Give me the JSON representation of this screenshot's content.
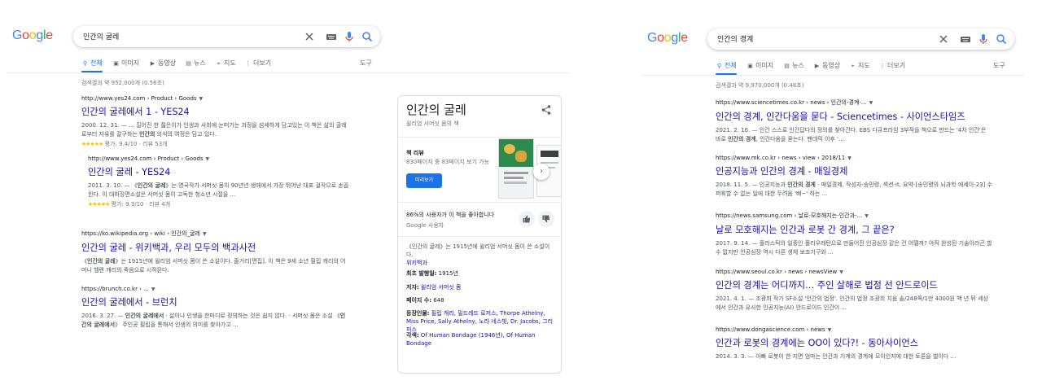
{
  "left": {
    "logo": "Google",
    "query": "인간의 굴레",
    "tabs": [
      {
        "label": "전체",
        "icon": "search-icon"
      },
      {
        "label": "이미지",
        "icon": "image-icon"
      },
      {
        "label": "동영상",
        "icon": "play-icon"
      },
      {
        "label": "뉴스",
        "icon": "news-icon"
      },
      {
        "label": "지도",
        "icon": "map-pin-icon"
      },
      {
        "label": "더보기",
        "icon": "more-vert-icon"
      }
    ],
    "tools_label": "도구",
    "stats": "검색결과 약 952,000개 (0.56초)",
    "results": [
      {
        "cite": "http://www.yes24.com › Product › Goods",
        "title": "인간의 굴레에서 1 - YES24",
        "snippet_html": "2000. 12. 31. — ... 질어진 한 젊은이가 인생과 사회에 눈떠가는 과정을 섬세하게 담고있는 이 책은 삶의 굴레로부터 자유를 갈구하는 <b>인간의</b> 의식의 여정은 담고 있다.",
        "rating_stars": "★★★★★",
        "rating_text": "평가: 9.4/10 · 리뷰 53개"
      },
      {
        "cite": "http://www.yes24.com › Product › Goods",
        "title": "인간의 굴레 - YES24",
        "snippet_html": "2011. 3. 10. — 《<b>인간의 굴레</b>》는 영국작가 서머싯 몸의 90년년 생애에서 가장 뛰어난 대표 걸작으로 손꼽힌다. 이 대하장편소설은 서머싯 몸이 고독한 청소년 시절을 ...",
        "rating_stars": "★★★★★",
        "rating_text": "평가: 9.3/10 · 리뷰 4개"
      },
      {
        "cite": "https://ko.wikipedia.org › wiki › 인간의_굴레",
        "title": "인간의 굴레 - 위키백과, 우리 모두의 백과사전",
        "snippet_html": "《<b>인간의 굴레</b>》는 1915년에 윌리엄 서머싯 몸이 쓴 소설이다. 줄거리[편집]. 이 책은 9세 소년 필립 캐리의 어머니 헬렌 캐리의 죽음으로 시작된다."
      },
      {
        "cite": "https://brunch.co.kr › ...",
        "title": "인간의 굴레에서 - 브런치",
        "snippet_html": "2016. 3. 27. — <b>인간의 굴레에서</b> · 삶이나 인생을 한마디로 정의하는 것은 쉽지 않다. · 서머싯 몸은 소설 《<b>인간의 굴레에서</b>》 주인공 필립을 통해서 인생의 의미를 찾아가고 ..."
      }
    ],
    "kp": {
      "title": "인간의 굴레",
      "subtitle": "윌리엄 서머싯 몸의 책",
      "book_review_label": "책 리뷰",
      "book_review_sub": "830페이지 중 83페이지 보기 가능",
      "preview_button": "미리보기",
      "like_text": "86%의 사용자가 이 책을 좋아합니다",
      "like_source": "Google 사용자",
      "desc": "《인간의 굴레》는 1915년에 윌리엄 서머싯 몸이 쓴 소설이다.",
      "wiki_link": "위키백과",
      "facts": [
        {
          "k": "최초 발행일:",
          "v": "1915년",
          "link": false
        },
        {
          "k": "저자:",
          "v": "윌리엄 서머싯 몸",
          "link": true
        },
        {
          "k": "페이지 수:",
          "v": "648",
          "link": false
        },
        {
          "k": "등장인물:",
          "v": "필립 캐리, 밀드레드 로저스, Thorpe Athelny, Miss Price, Sally Athelny, 노라 네스빗, Dr. Jacobs, 그리피스",
          "link": true
        },
        {
          "k": "각색:",
          "v": "Of Human Bondage (1946년), Of Human Bondage",
          "link": true
        }
      ]
    }
  },
  "right": {
    "logo": "Google",
    "query": "인간의 경계",
    "tabs": [
      {
        "label": "전체",
        "icon": "search-icon"
      },
      {
        "label": "이미지",
        "icon": "image-icon"
      },
      {
        "label": "뉴스",
        "icon": "news-icon"
      },
      {
        "label": "동영상",
        "icon": "play-icon"
      },
      {
        "label": "지도",
        "icon": "map-pin-icon"
      },
      {
        "label": "더보기",
        "icon": "more-vert-icon"
      }
    ],
    "tools_label": "도구",
    "stats": "검색결과 약 9,970,000개 (0.48초)",
    "results": [
      {
        "cite": "https://www.sciencetimes.co.kr › news › 인간의-경계-...",
        "title": "인간의 경계, 인간다움을 묻다 - Sciencetimes - 사이언스타임즈",
        "snippet_html": "2021. 2. 16. — 인간 스스로 인간답다의 정의를 찾아간다. EBS 다큐프라임 3부작을 책으로 만드는 '4차 인간'은 바로 <b>인간의 경계</b>, 인간다움을 묻는다. 팬데믹 이후 '..."
      },
      {
        "cite": "https://www.mk.co.kr › news › view › 2018/11",
        "title": "인공지능과 인간의 경계 - 매일경제",
        "snippet_html": "2018. 11. 5. — 인공지능과 <b>인간의 경계</b> - 매일경제, 작성자-송민령, 섹션-it, 요약-[송민령의 뇌과학 에세이-23] 수퍼휘할 수 없는 일에 대한 두려움 '삐~' 하는 ..."
      },
      {
        "cite": "https://news.samsung.com › 날로-모호해지는-인간과-...",
        "title": "날로 모호해지는 인간과 로봇 간 경계, 그 끝은?",
        "snippet_html": "2017. 9. 14. — 플라스틱의 일종인 폴리우레탄으로 만들어진 인공심장 같은 건 어떨까? 아직 완성된 기술이라곤 할 수 없지만 인공심장 역시 다른 생체 보조기구와 ..."
      },
      {
        "cite": "https://www.seoul.co.kr › news › newsView",
        "title": "인간의 경계는 어디까지… 주인 살해로 법정 선 안드로이드",
        "snippet_html": "2021. 4. 1. — 조광희 작가 SF소설 '인간의 법정'. 인간의 법정 조광희 지음 솔/248쪽/1만 4000원 백 년 뒤 세상에서 인간과 유사한 인공지능(AI) 안드로이드 인간이 ..."
      },
      {
        "cite": "https://www.dongascience.com › news",
        "title": "인간과 로봇의 경계에는 OO이 있다?! - 동아사이언스",
        "snippet_html": "2014. 3. 3. — 아빠 로봇이 한 지면 엄마는 안간과 기계의 경계에 모이인지에 대한 토론을 벌이다 ..."
      }
    ]
  },
  "colors": {
    "link": "#1a0dab",
    "accent": "#1a73e8",
    "star": "#fbbc04",
    "logo_blue": "#4285f4",
    "logo_red": "#ea4335",
    "logo_yellow": "#fbbc05",
    "logo_green": "#34a853"
  }
}
